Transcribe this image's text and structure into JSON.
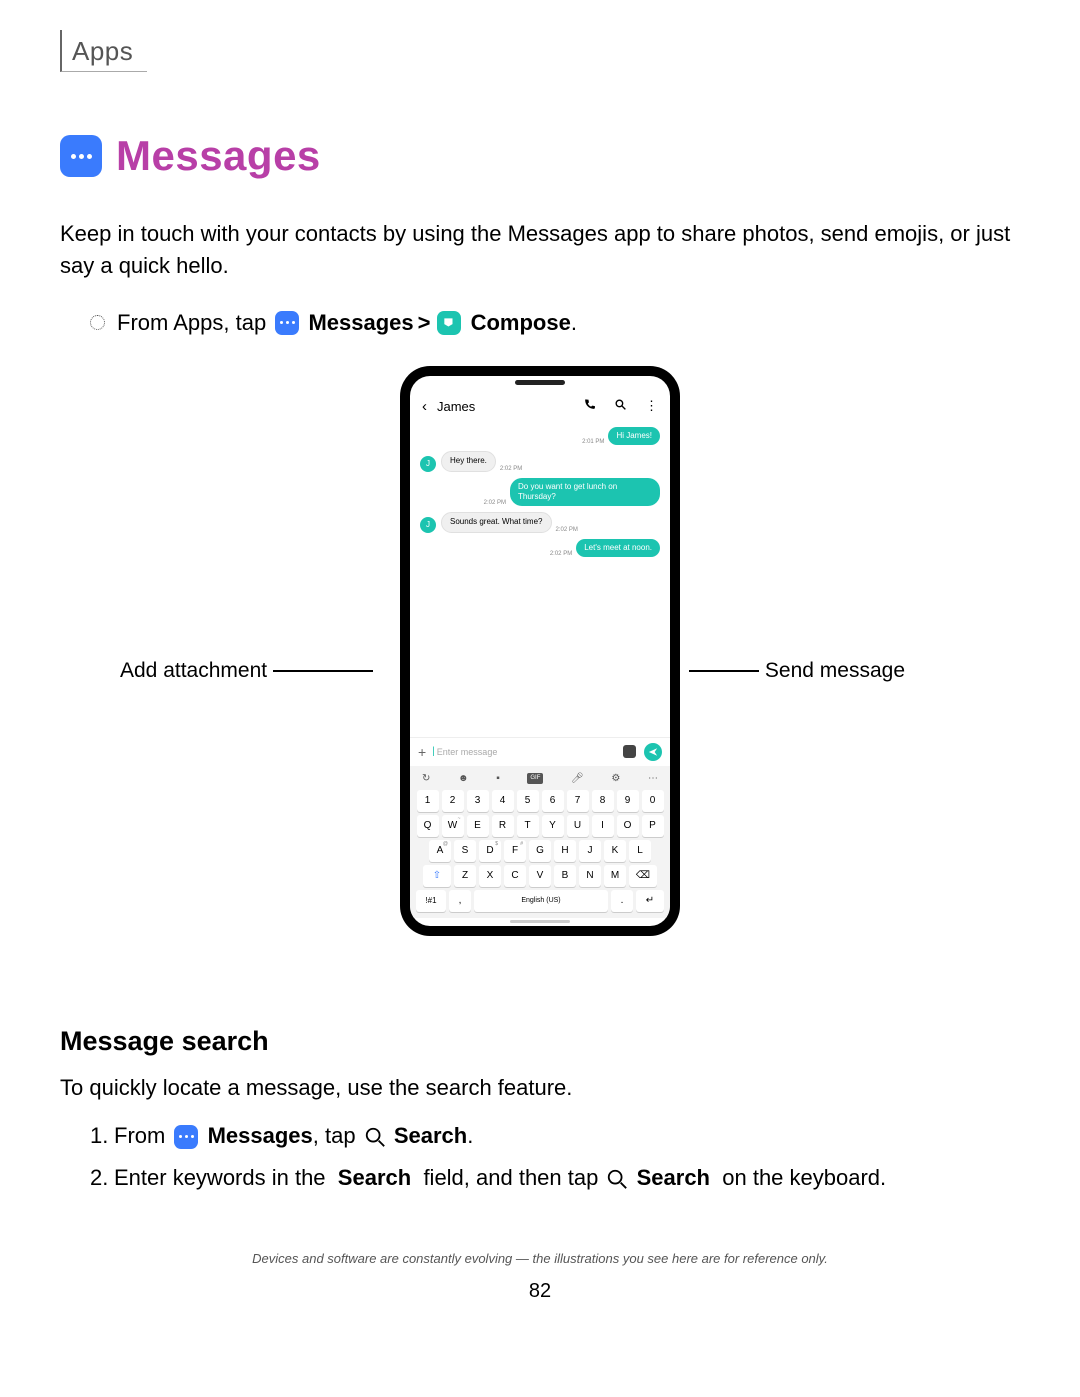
{
  "header": {
    "section": "Apps"
  },
  "title": "Messages",
  "intro": "Keep in touch with your contacts by using the Messages app to share photos, send emojis, or just say a quick hello.",
  "step": {
    "prefix": "From Apps, tap",
    "app1": "Messages",
    "sep": ">",
    "app2": "Compose",
    "period": "."
  },
  "callouts": {
    "left": "Add attachment",
    "right": "Send message"
  },
  "phone": {
    "contact": "James",
    "avatar_initial": "J",
    "messages": [
      {
        "side": "right",
        "text": "Hi James!",
        "time": "2:01 PM"
      },
      {
        "side": "left",
        "text": "Hey there.",
        "time": "2:02 PM"
      },
      {
        "side": "right",
        "text": "Do you want to get lunch on Thursday?",
        "time": "2:02 PM"
      },
      {
        "side": "left",
        "text": "Sounds great. What time?",
        "time": "2:02 PM"
      },
      {
        "side": "right",
        "text": "Let's meet at noon.",
        "time": "2:02 PM"
      }
    ],
    "input_placeholder": "Enter message",
    "keyboard": {
      "row1": [
        "1",
        "2",
        "3",
        "4",
        "5",
        "6",
        "7",
        "8",
        "9",
        "0"
      ],
      "row2": [
        "Q",
        "W",
        "E",
        "R",
        "T",
        "Y",
        "U",
        "I",
        "O",
        "P"
      ],
      "row2_sup": [
        "",
        "~",
        "",
        "",
        "",
        "",
        "",
        "",
        "",
        ""
      ],
      "row3": [
        "A",
        "S",
        "D",
        "F",
        "G",
        "H",
        "J",
        "K",
        "L"
      ],
      "row3_sup": [
        "@",
        "",
        "$",
        "#",
        "",
        "",
        "",
        "",
        ""
      ],
      "row4": [
        "Z",
        "X",
        "C",
        "V",
        "B",
        "N",
        "M"
      ],
      "sym": "!#1",
      "comma": ",",
      "lang": "English (US)",
      "period": "."
    }
  },
  "subheading": "Message search",
  "sub_intro": "To quickly locate a message, use the search feature.",
  "list": {
    "i1_a": "From",
    "i1_b": "Messages",
    "i1_c": ", tap",
    "i1_d": "Search",
    "i1_e": ".",
    "i2_a": "Enter keywords in the",
    "i2_b": "Search",
    "i2_c": "field, and then tap",
    "i2_d": "Search",
    "i2_e": "on the keyboard."
  },
  "footnote": "Devices and software are constantly evolving — the illustrations you see here are for reference only.",
  "page": "82"
}
